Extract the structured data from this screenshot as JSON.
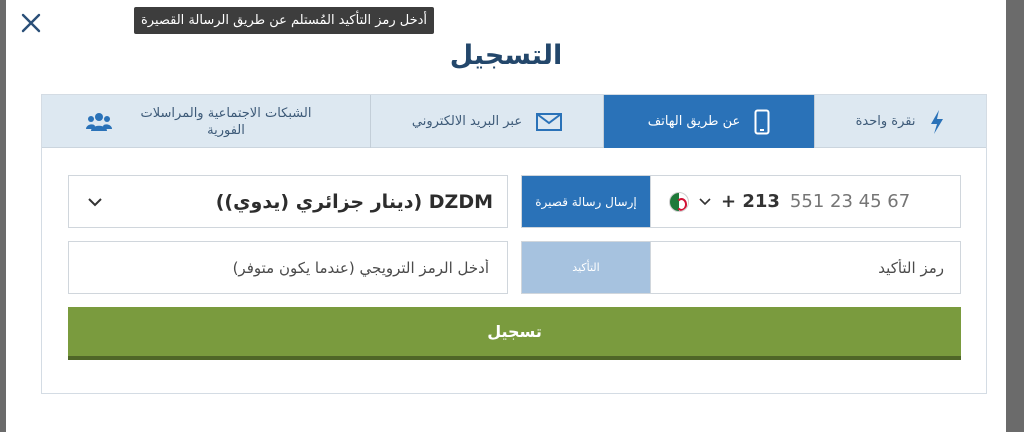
{
  "tooltip": "أدخل رمز التأكيد المُستلم عن طريق الرسالة القصيرة",
  "title": "التسجيل",
  "tabs": [
    {
      "label": "الشبكات الاجتماعية والمراسلات الفورية",
      "icon": "users-icon",
      "active": false
    },
    {
      "label": "عبر البريد الالكتروني",
      "icon": "envelope-icon",
      "active": false
    },
    {
      "label": "عن طريق الهاتف",
      "icon": "phone-icon",
      "active": true
    },
    {
      "label": "نقرة واحدة",
      "icon": "lightning-icon",
      "active": false
    }
  ],
  "currency": {
    "value": "DZDM (دينار جزائري (يدوي))"
  },
  "phone": {
    "send_sms_label": "إرسال رسالة قصيرة",
    "country_code": "+ 213",
    "placeholder": "551 23 45 67",
    "flag": "algeria-flag-icon"
  },
  "promo": {
    "placeholder": "أدخل الرمز الترويجي (عندما يكون متوفر)"
  },
  "confirmation": {
    "placeholder": "رمز التأكيد",
    "confirm_label": "التأكيد"
  },
  "register_label": "تسجيل",
  "colors": {
    "title": "#23476b",
    "accent": "#2a72b8",
    "confirm_disabled": "#a6c2df",
    "register": "#7a9b3e",
    "tab_bg": "#dde8f1"
  }
}
